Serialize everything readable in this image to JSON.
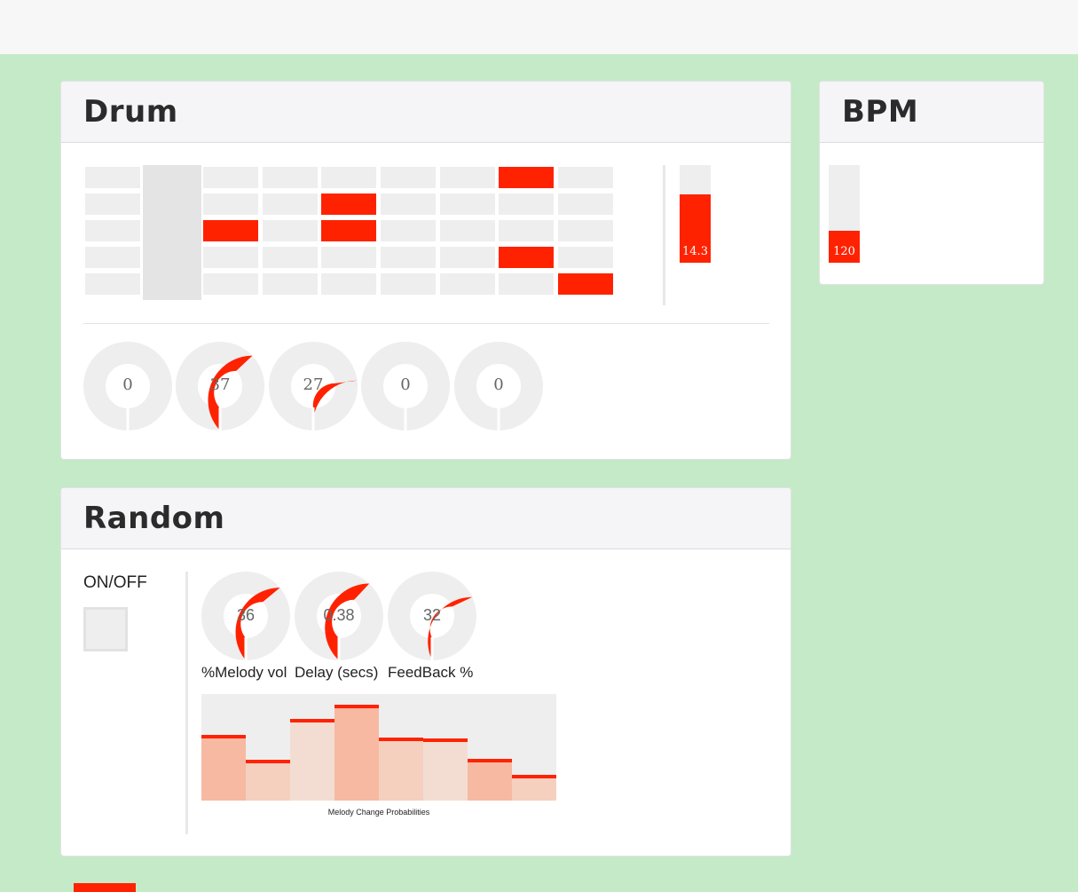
{
  "drum": {
    "title": "Drum",
    "matrix": {
      "columns": 9,
      "rows": 5,
      "active_column": 1,
      "on_cells": [
        [
          0,
          7
        ],
        [
          1,
          4
        ],
        [
          2,
          2
        ],
        [
          2,
          4
        ],
        [
          3,
          7
        ],
        [
          4,
          8
        ]
      ]
    },
    "slider": {
      "value": "14.3",
      "fraction": 0.7
    },
    "dials": [
      {
        "value": "0",
        "fraction": 0
      },
      {
        "value": "37",
        "fraction": 0.37
      },
      {
        "value": "27",
        "fraction": 0.27
      },
      {
        "value": "0",
        "fraction": 0
      },
      {
        "value": "0",
        "fraction": 0
      }
    ]
  },
  "bpm": {
    "title": "BPM",
    "slider": {
      "value": "120",
      "fraction": 0.33
    }
  },
  "random": {
    "title": "Random",
    "onoff_label": "ON/OFF",
    "toggle_on": false,
    "dials": [
      {
        "value": "36",
        "fraction": 0.36,
        "label": "Melody vol%"
      },
      {
        "value": "0.38",
        "fraction": 0.38,
        "label": "Delay (secs)"
      },
      {
        "value": "32",
        "fraction": 0.32,
        "label": "FeedBack %"
      }
    ],
    "multislider": {
      "caption": "Melody Change Probabilities",
      "values": [
        0.62,
        0.38,
        0.77,
        0.9,
        0.59,
        0.58,
        0.39,
        0.24
      ],
      "fill_colors": [
        "#f7b9a2",
        "#f5d0bf",
        "#f3ddd2",
        "#f7b9a2",
        "#f5d0bf",
        "#f3ddd2",
        "#f7b9a2",
        "#f5d0bf"
      ]
    }
  },
  "colors": {
    "accent": "#ff2200",
    "track": "#eeeeee",
    "background": "#c5eac8"
  }
}
